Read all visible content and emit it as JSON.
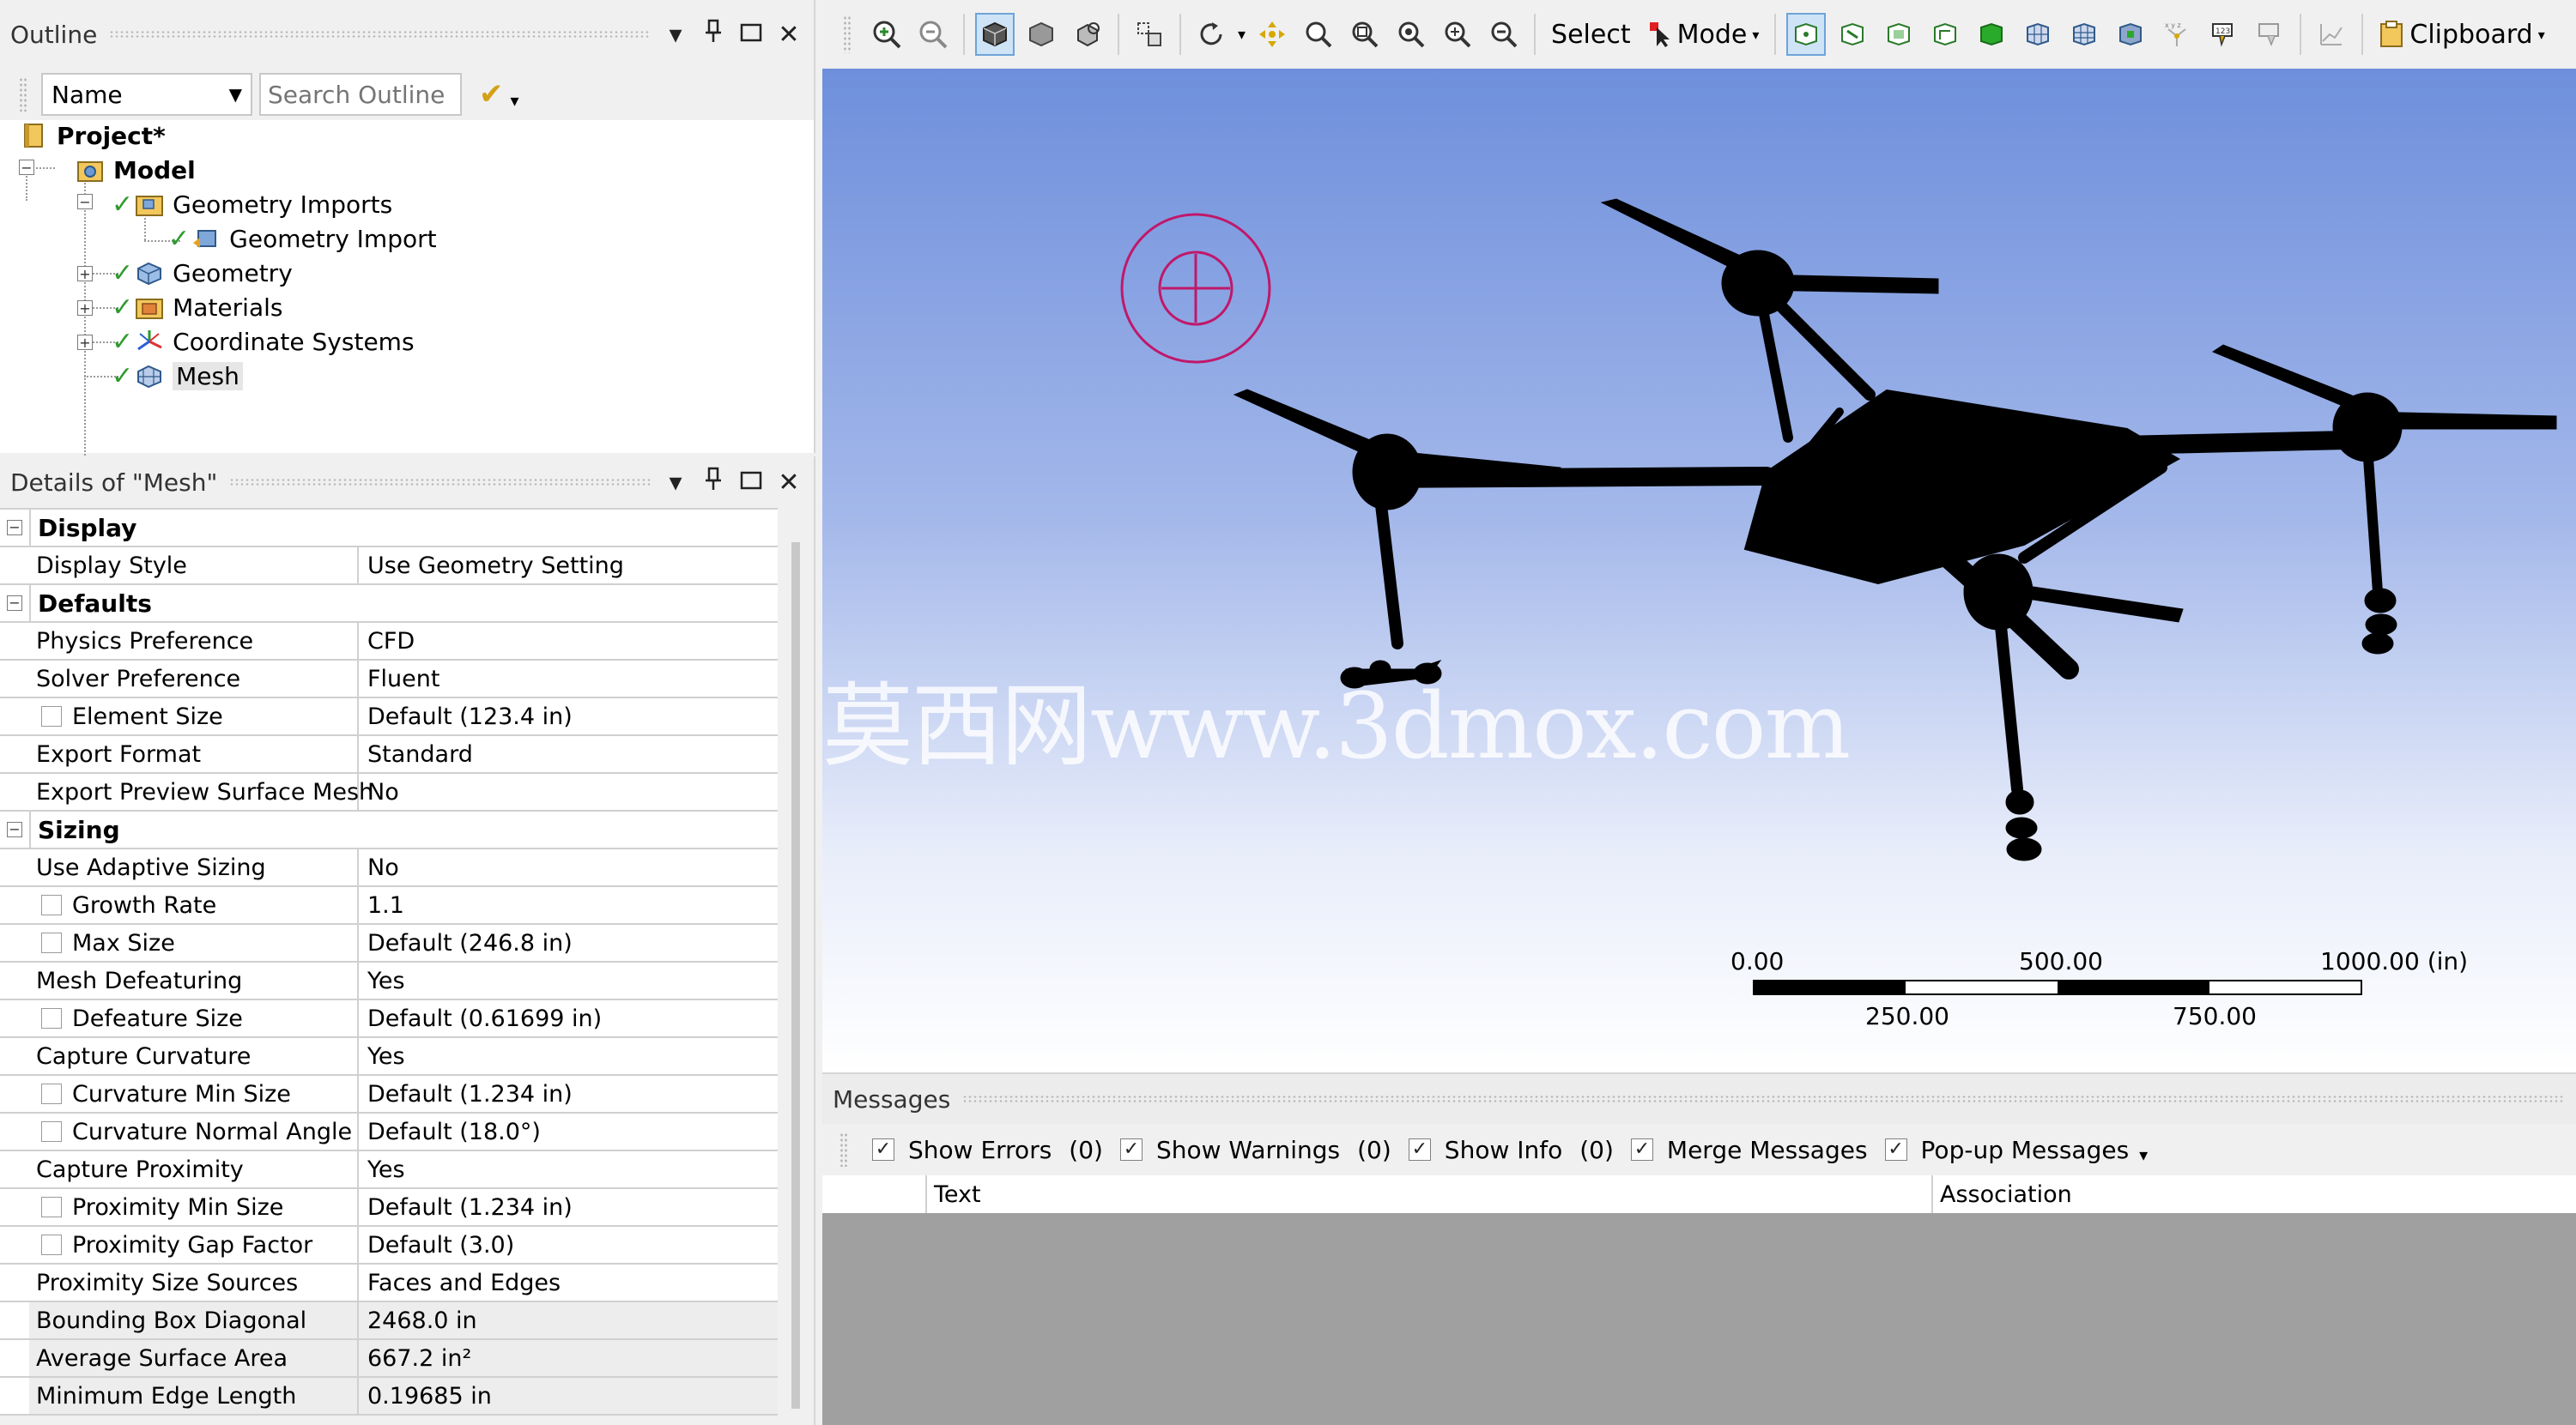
{
  "outline": {
    "title": "Outline",
    "filter_field": "Name",
    "search_placeholder": "Search Outline",
    "tree": [
      {
        "label": "Project*",
        "bold": true
      },
      {
        "label": "Model",
        "bold": true
      },
      {
        "label": "Geometry Imports"
      },
      {
        "label": "Geometry Import"
      },
      {
        "label": "Geometry"
      },
      {
        "label": "Materials"
      },
      {
        "label": "Coordinate Systems"
      },
      {
        "label": "Mesh",
        "selected": true
      }
    ]
  },
  "details": {
    "title": "Details of \"Mesh\"",
    "rows": [
      {
        "type": "group",
        "label": "Display"
      },
      {
        "label": "Display Style",
        "value": "Use Geometry Setting"
      },
      {
        "type": "group",
        "label": "Defaults"
      },
      {
        "label": "Physics Preference",
        "value": "CFD"
      },
      {
        "label": "Solver Preference",
        "value": "Fluent"
      },
      {
        "label": "Element Size",
        "value": "Default (123.4 in)",
        "checkbox": true
      },
      {
        "label": "Export Format",
        "value": "Standard"
      },
      {
        "label": "Export Preview Surface Mesh",
        "value": "No"
      },
      {
        "type": "group",
        "label": "Sizing"
      },
      {
        "label": "Use Adaptive Sizing",
        "value": "No"
      },
      {
        "label": "Growth Rate",
        "value": "1.1",
        "checkbox": true
      },
      {
        "label": "Max Size",
        "value": "Default (246.8 in)",
        "checkbox": true
      },
      {
        "label": "Mesh Defeaturing",
        "value": "Yes"
      },
      {
        "label": "Defeature Size",
        "value": "Default (0.61699 in)",
        "checkbox": true
      },
      {
        "label": "Capture Curvature",
        "value": "Yes"
      },
      {
        "label": "Curvature Min Size",
        "value": "Default (1.234 in)",
        "checkbox": true
      },
      {
        "label": "Curvature Normal Angle",
        "value": "Default (18.0°)",
        "checkbox": true
      },
      {
        "label": "Capture Proximity",
        "value": "Yes"
      },
      {
        "label": "Proximity Min Size",
        "value": "Default (1.234 in)",
        "checkbox": true
      },
      {
        "label": "Proximity Gap Factor",
        "value": "Default (3.0)",
        "checkbox": true
      },
      {
        "label": "Proximity Size Sources",
        "value": "Faces and Edges"
      },
      {
        "label": "Bounding Box Diagonal",
        "value": "2468.0 in",
        "readonly": true
      },
      {
        "label": "Average Surface Area",
        "value": "667.2 in²",
        "readonly": true
      },
      {
        "label": "Minimum Edge Length",
        "value": "0.19685 in"
      }
    ]
  },
  "toolbar": {
    "select_label": "Select",
    "mode_label": "Mode",
    "clipboard_label": "Clipboard"
  },
  "viewport": {
    "watermark": "莫西网www.3dmox.com",
    "scale": {
      "top_labels": [
        "0.00",
        "500.00",
        "1000.00 (in)"
      ],
      "bottom_labels": [
        "250.00",
        "750.00"
      ]
    }
  },
  "messages": {
    "title": "Messages",
    "options": [
      {
        "label": "Show Errors",
        "count": "(0)"
      },
      {
        "label": "Show Warnings",
        "count": "(0)"
      },
      {
        "label": "Show Info",
        "count": "(0)"
      },
      {
        "label": "Merge Messages",
        "count": ""
      },
      {
        "label": "Pop-up Messages",
        "count": ""
      }
    ],
    "columns": [
      "Text",
      "Association"
    ]
  }
}
